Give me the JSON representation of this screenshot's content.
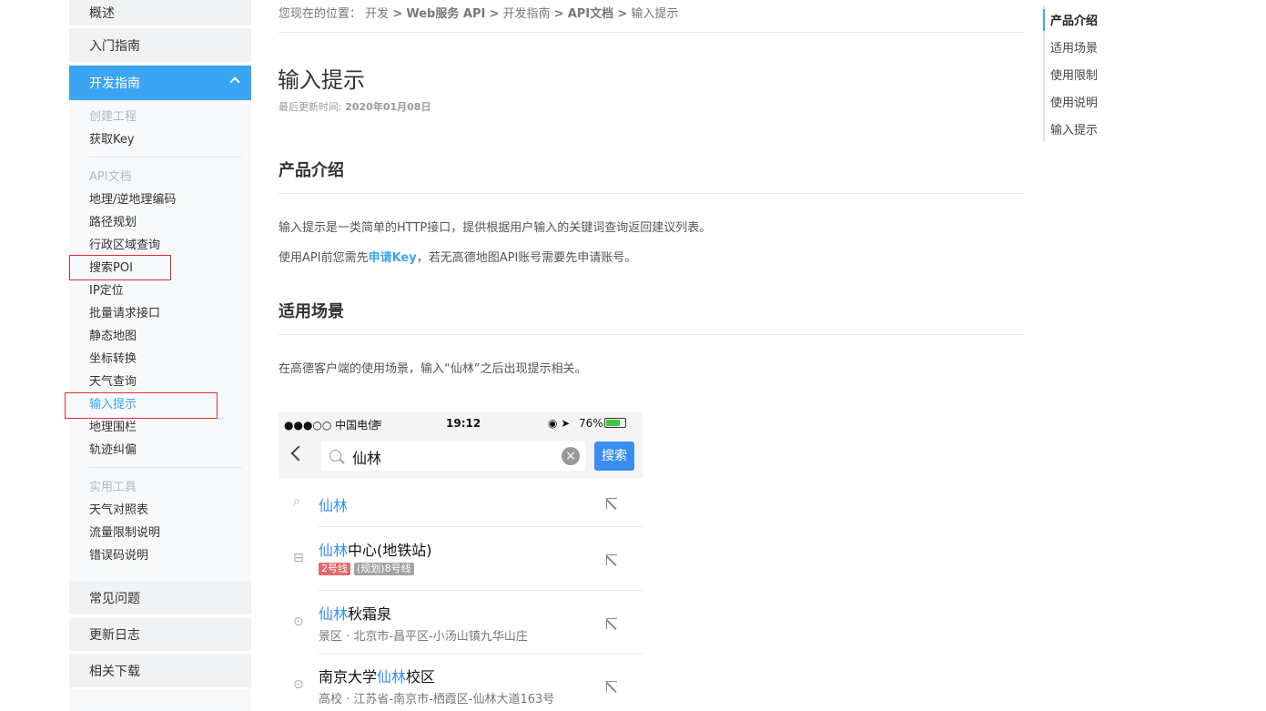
{
  "sidebar": {
    "overview": "概述",
    "intro_guide": "入门指南",
    "dev_guide": "开发指南",
    "create_project": "创建工程",
    "get_key": "获取Key",
    "api_docs_category": "API文档",
    "api_items": [
      "地理/逆地理编码",
      "路径规划",
      "行政区域查询",
      "搜索POI",
      "IP定位",
      "批量请求接口",
      "静态地图",
      "坐标转换",
      "天气查询",
      "输入提示",
      "地理围栏",
      "轨迹纠偏"
    ],
    "tools_category": "实用工具",
    "tool_items": [
      "天气对照表",
      "流量限制说明",
      "错误码说明"
    ],
    "faq": "常见问题",
    "changelog": "更新日志",
    "downloads": "相关下载"
  },
  "breadcrumb": {
    "prefix": "您现在的位置：",
    "items": [
      "开发",
      "Web服务 API",
      "开发指南",
      "API文档",
      "输入提示"
    ],
    "sep": ">"
  },
  "page": {
    "title": "输入提示",
    "updated_label": "最后更新时间:",
    "updated_date": "2020年01月08日"
  },
  "sections": {
    "intro_heading": "产品介绍",
    "intro_p1": "输入提示是一类简单的HTTP接口，提供根据用户输入的关键词查询返回建议列表。",
    "intro_p2_before": "使用API前您需先",
    "intro_p2_link": "申请Key",
    "intro_p2_after": "，若无高德地图API账号需要先申请账号。",
    "scene_heading": "适用场景",
    "scene_p1": "在高德客户端的使用场景，输入“仙林”之后出现提示相关。"
  },
  "toc": {
    "items": [
      "产品介绍",
      "适用场景",
      "使用限制",
      "使用说明",
      "输入提示"
    ]
  },
  "phone": {
    "signal": "●●●○○ 中国电信",
    "wifi": "≋",
    "time": "19:12",
    "status_icons": "◉ ➤",
    "battery_pct": "76%",
    "battery_level": 0.76,
    "search_value": "仙林",
    "clear_symbol": "×",
    "search_button": "搜索",
    "results": [
      {
        "hl": "仙林",
        "rest": "",
        "sub": "",
        "tags": []
      },
      {
        "hl": "仙林",
        "rest": "中心(地铁站)",
        "sub": "",
        "tags": [
          {
            "text": "2号线",
            "color": "#e26a6a"
          },
          {
            "text": "(规划)8号线",
            "color": "#a3a3a3"
          }
        ]
      },
      {
        "hl": "仙林",
        "rest": "秋霜泉",
        "sub": "景区 · 北京市-昌平区-小汤山镇九华山庄",
        "tags": []
      },
      {
        "pre": "南京大学",
        "hl": "仙林",
        "rest": "校区",
        "sub": "高校 · 江苏省-南京市-栖霞区-仙林大道163号",
        "tags": []
      }
    ]
  },
  "colors": {
    "accent": "#3aa5f2",
    "highlight_box": "#d9303a",
    "phone_accent": "#3b8ef1"
  }
}
